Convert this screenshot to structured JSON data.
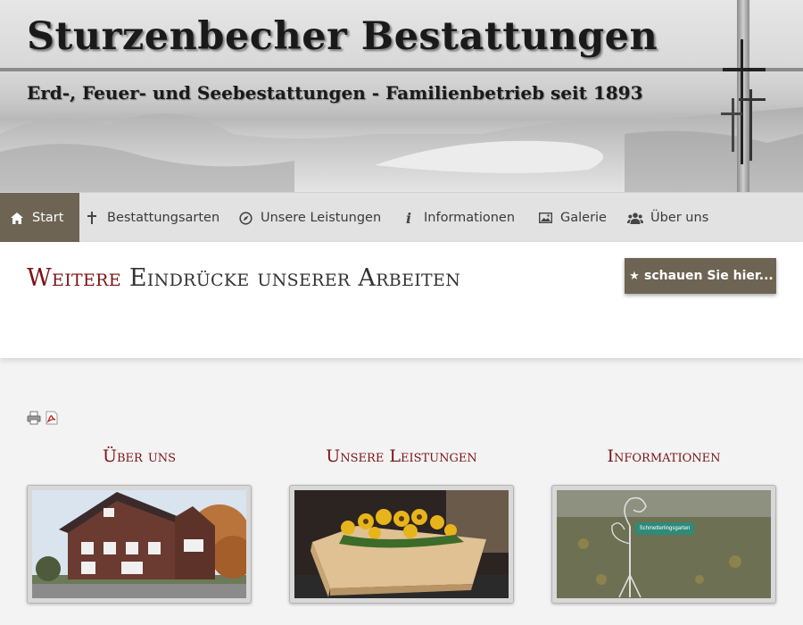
{
  "header": {
    "title": "Sturzenbecher Bestattungen",
    "subtitle": "Erd-, Feuer- und Seebestattungen - Familienbetrieb seit 1893"
  },
  "nav": {
    "items": [
      {
        "label": "Start",
        "icon": "home-icon",
        "active": true
      },
      {
        "label": "Bestattungsarten",
        "icon": "cross-icon"
      },
      {
        "label": "Unsere Leistungen",
        "icon": "compass-icon"
      },
      {
        "label": "Informationen",
        "icon": "info-icon"
      },
      {
        "label": "Galerie",
        "icon": "image-icon"
      },
      {
        "label": "Über uns",
        "icon": "users-icon"
      }
    ]
  },
  "page": {
    "title_accent": "Weitere",
    "title_rest": "Eindrücke unserer Arbeiten",
    "cta_label": "schauen Sie hier..."
  },
  "tools": [
    "print-icon",
    "pdf-icon"
  ],
  "columns": [
    {
      "title": "Über uns",
      "image": "house-photo"
    },
    {
      "title": "Unsere Leistungen",
      "image": "coffin-photo"
    },
    {
      "title": "Informationen",
      "image": "sign-photo",
      "sign_text": "Schmetterlingsgarten"
    }
  ],
  "colors": {
    "accent": "#7a1416",
    "nav_active": "#6e6453",
    "nav_bg": "#e2e2e2"
  }
}
